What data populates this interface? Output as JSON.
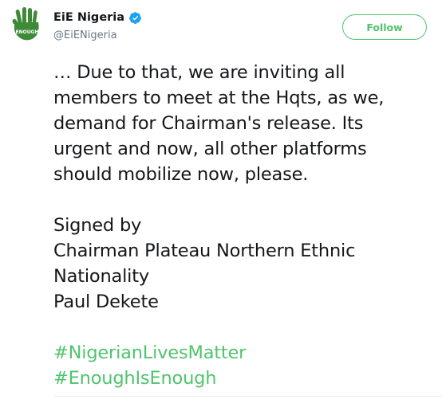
{
  "author": {
    "display_name": "EiE Nigeria",
    "handle": "@EiENigeria",
    "verified_icon": "verified-badge-icon",
    "avatar_text": "ENOUGH",
    "colors": {
      "avatar_green": "#3d8b37",
      "verified_blue": "#1da1f2"
    }
  },
  "follow_button": {
    "label": "Follow",
    "color": "#51c46e"
  },
  "tweet": {
    "paragraph1": [
      "… Due to that, we are inviting all",
      "members to meet at the Hqts, as we,",
      "demand for Chairman's release. Its",
      "urgent and now, all other platforms",
      "should mobilize now, please."
    ],
    "paragraph2": [
      "Signed by",
      "Chairman Plateau Northern Ethnic",
      "Nationality",
      "Paul Dekete"
    ],
    "hashtags": [
      "#NigerianLivesMatter",
      "#EnoughIsEnough"
    ],
    "hashtag_color": "#51c46e"
  }
}
